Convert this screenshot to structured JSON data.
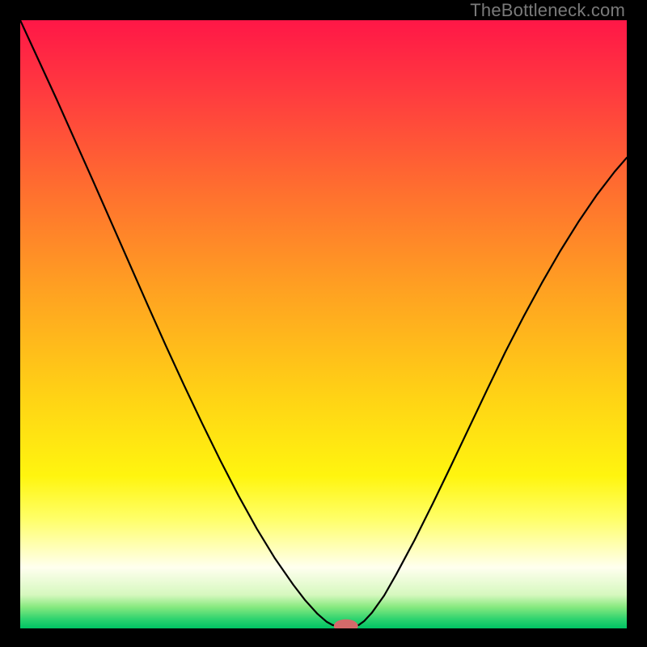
{
  "watermark": "TheBottleneck.com",
  "chart_data": {
    "type": "line",
    "title": "",
    "xlabel": "",
    "ylabel": "",
    "xlim": [
      0,
      100
    ],
    "ylim": [
      0,
      100
    ],
    "background_gradient": {
      "stops": [
        {
          "offset": 0.0,
          "color": "#ff1747"
        },
        {
          "offset": 0.12,
          "color": "#ff3b3f"
        },
        {
          "offset": 0.28,
          "color": "#ff6f2f"
        },
        {
          "offset": 0.45,
          "color": "#ffa321"
        },
        {
          "offset": 0.62,
          "color": "#ffd315"
        },
        {
          "offset": 0.75,
          "color": "#fff50f"
        },
        {
          "offset": 0.82,
          "color": "#ffff68"
        },
        {
          "offset": 0.9,
          "color": "#ffffef"
        },
        {
          "offset": 0.945,
          "color": "#d6f8be"
        },
        {
          "offset": 0.965,
          "color": "#86e97f"
        },
        {
          "offset": 0.985,
          "color": "#2dd36f"
        },
        {
          "offset": 1.0,
          "color": "#00c464"
        }
      ]
    },
    "series": [
      {
        "name": "bottleneck-curve",
        "color": "#000000",
        "stroke_width": 2.2,
        "points": [
          {
            "x": 0.0,
            "y": 100.0
          },
          {
            "x": 3.0,
            "y": 93.5
          },
          {
            "x": 6.0,
            "y": 87.0
          },
          {
            "x": 9.0,
            "y": 80.3
          },
          {
            "x": 12.0,
            "y": 73.6
          },
          {
            "x": 15.0,
            "y": 66.8
          },
          {
            "x": 18.0,
            "y": 60.0
          },
          {
            "x": 21.0,
            "y": 53.2
          },
          {
            "x": 24.0,
            "y": 46.5
          },
          {
            "x": 27.0,
            "y": 40.0
          },
          {
            "x": 30.0,
            "y": 33.7
          },
          {
            "x": 33.0,
            "y": 27.6
          },
          {
            "x": 36.0,
            "y": 21.8
          },
          {
            "x": 39.0,
            "y": 16.4
          },
          {
            "x": 42.0,
            "y": 11.5
          },
          {
            "x": 45.0,
            "y": 7.2
          },
          {
            "x": 47.0,
            "y": 4.6
          },
          {
            "x": 49.0,
            "y": 2.4
          },
          {
            "x": 50.5,
            "y": 1.1
          },
          {
            "x": 51.5,
            "y": 0.55
          },
          {
            "x": 52.3,
            "y": 0.4
          },
          {
            "x": 53.0,
            "y": 0.4
          },
          {
            "x": 54.3,
            "y": 0.4
          },
          {
            "x": 55.0,
            "y": 0.4
          },
          {
            "x": 55.8,
            "y": 0.55
          },
          {
            "x": 56.7,
            "y": 1.2
          },
          {
            "x": 58.0,
            "y": 2.6
          },
          {
            "x": 60.0,
            "y": 5.4
          },
          {
            "x": 62.0,
            "y": 8.9
          },
          {
            "x": 65.0,
            "y": 14.5
          },
          {
            "x": 68.0,
            "y": 20.5
          },
          {
            "x": 71.0,
            "y": 26.7
          },
          {
            "x": 74.0,
            "y": 33.0
          },
          {
            "x": 77.0,
            "y": 39.3
          },
          {
            "x": 80.0,
            "y": 45.5
          },
          {
            "x": 83.0,
            "y": 51.3
          },
          {
            "x": 86.0,
            "y": 56.8
          },
          {
            "x": 89.0,
            "y": 62.0
          },
          {
            "x": 92.0,
            "y": 66.8
          },
          {
            "x": 95.0,
            "y": 71.2
          },
          {
            "x": 98.0,
            "y": 75.1
          },
          {
            "x": 100.0,
            "y": 77.4
          }
        ]
      }
    ],
    "marker": {
      "name": "optimal-point",
      "x": 53.7,
      "y": 0.4,
      "rx": 2.0,
      "ry": 1.1,
      "color": "#d46a6a"
    }
  }
}
